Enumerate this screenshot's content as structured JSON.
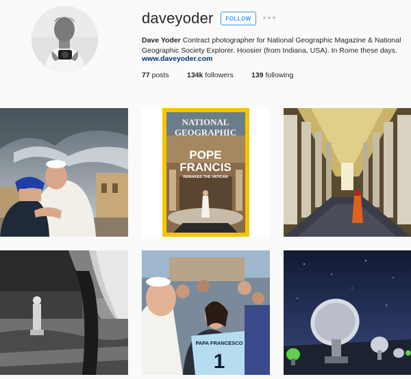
{
  "profile": {
    "username": "daveyoder",
    "follow_label": "FOLLOW",
    "bio_name": "Dave Yoder",
    "bio_text": " Contract photographer for National Geographic Magazine & National Geographic Society Explorer. Hoosier (from Indiana, USA). In Rome these days.",
    "website": "www.daveyoder.com"
  },
  "stats": {
    "posts_count": "77",
    "posts_label": " posts",
    "followers_count": "134k",
    "followers_label": " followers",
    "following_count": "139",
    "following_label": " following"
  },
  "posts": {
    "magazine": {
      "masthead_line1": "NATIONAL",
      "masthead_line2": "GEOGRAPHIC",
      "headline_line1": "POPE",
      "headline_line2": "FRANCIS",
      "subheadline": "REMAKES THE VATICAN"
    },
    "jersey": {
      "name": "PAPA FRANCESCO",
      "number": "1"
    }
  },
  "colors": {
    "accent": "#3897f0",
    "link": "#003569",
    "ng_yellow": "#f5c400"
  }
}
